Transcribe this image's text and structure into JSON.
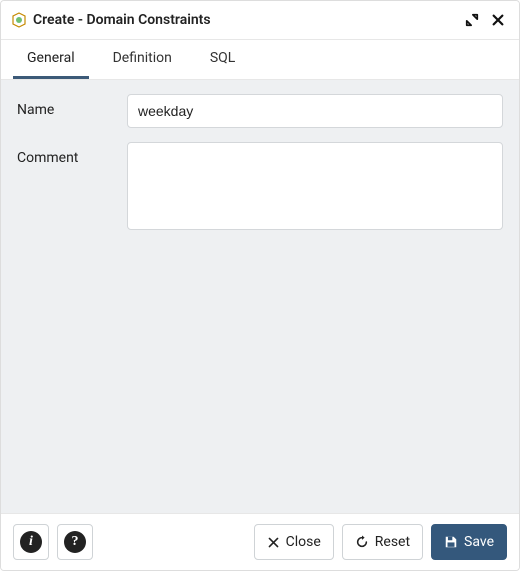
{
  "window": {
    "title": "Create - Domain Constraints"
  },
  "tabs": [
    {
      "label": "General",
      "active": true
    },
    {
      "label": "Definition",
      "active": false
    },
    {
      "label": "SQL",
      "active": false
    }
  ],
  "form": {
    "name": {
      "label": "Name",
      "value": "weekday"
    },
    "comment": {
      "label": "Comment",
      "value": ""
    }
  },
  "footer": {
    "close_label": "Close",
    "reset_label": "Reset",
    "save_label": "Save"
  }
}
